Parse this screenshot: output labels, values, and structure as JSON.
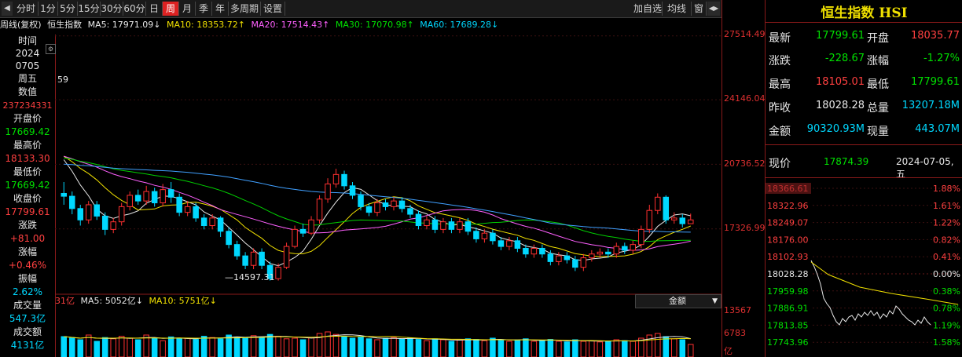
{
  "toolbar": {
    "periods": [
      "分时",
      "1分",
      "5分",
      "15分",
      "30分",
      "60分",
      "日",
      "周",
      "月",
      "季",
      "年",
      "多周期",
      "设置"
    ],
    "active": "周",
    "right_buttons": [
      "加自选",
      "均线",
      "窗"
    ]
  },
  "header": {
    "label": "周线(复权)",
    "name": "恒生指数",
    "ma5": "MA5: 17971.09↓",
    "ma10": "MA10: 18353.72↑",
    "ma20": "MA20: 17514.43↑",
    "ma30": "MA30: 17070.98↑",
    "ma60": "MA60: 17689.28↓"
  },
  "left_info": {
    "time_label": "时间",
    "year": "2024",
    "date": "0705",
    "weekday": "周五",
    "value_label": "数值",
    "value": "237234331",
    "open_label": "开盘价",
    "open": "17669.42",
    "high_label": "最高价",
    "high": "18133.30",
    "low_label": "最低价",
    "low": "17669.42",
    "close_label": "收盘价",
    "close": "17799.61",
    "change_label": "涨跌",
    "change": "+81.00",
    "pct_label": "涨幅",
    "pct": "+0.46%",
    "amp_label": "振幅",
    "amp": "2.62%",
    "vol_label": "成交量",
    "vol": "547.3亿",
    "amt_label": "成交额",
    "amt": "4131亿"
  },
  "chart_annotations": {
    "low_marker": "14597.31",
    "left_partial": "59"
  },
  "y_axis": [
    "27514.49",
    "24146.04",
    "20736.52",
    "17326.99"
  ],
  "volume": {
    "label_partial": "31亿",
    "ma5": "MA5: 5052亿↓",
    "ma10": "MA10: 5751亿↓",
    "selector": "金额",
    "ticks": [
      "13567",
      "6783"
    ],
    "unit": "亿"
  },
  "quote_panel": {
    "title": "恒生指数 HSI",
    "latest_label": "最新",
    "latest": "17799.61",
    "open_label": "开盘",
    "open": "18035.77",
    "change_label": "涨跌",
    "change": "-228.67",
    "pct_label": "涨幅",
    "pct": "-1.27%",
    "high_label": "最高",
    "high": "18105.01",
    "low_label": "最低",
    "low": "17799.61",
    "prev_label": "昨收",
    "prev": "18028.28",
    "vol_label": "总量",
    "vol": "13207.18M",
    "amt_label": "金额",
    "amt": "90320.93M",
    "cur_label": "现量",
    "cur": "443.07M",
    "now_label": "现价",
    "now": "17874.39",
    "now_date": "2024-07-05,五"
  },
  "mini_chart": {
    "left_ticks": [
      "18366.61",
      "18322.96",
      "18249.07",
      "18176.00",
      "18102.93",
      "18028.28",
      "17959.98",
      "17886.91",
      "17813.85",
      "17743.96"
    ],
    "right_ticks": [
      "1.88%",
      "1.61%",
      "1.22%",
      "0.82%",
      "0.41%",
      "0.00%",
      "0.38%",
      "0.78%",
      "1.19%",
      "1.58%"
    ]
  },
  "colors": {
    "up": "#ff3030",
    "down": "#00d8ff",
    "ma5": "#e8e8e8",
    "ma10": "#f0e000",
    "ma20": "#ff60ff",
    "ma30": "#00d000",
    "ma60": "#40a0ff"
  },
  "chart_data": {
    "type": "candlestick",
    "title": "恒生指数 周线",
    "ylim": [
      14000,
      28500
    ],
    "candles": [
      [
        19200,
        19050,
        19800,
        18600
      ],
      [
        19050,
        18400,
        19300,
        18100
      ],
      [
        18400,
        17800,
        18600,
        17500
      ],
      [
        17800,
        18600,
        18800,
        17600
      ],
      [
        18600,
        18000,
        18800,
        17800
      ],
      [
        18000,
        17300,
        18200,
        17000
      ],
      [
        17300,
        17700,
        17900,
        17100
      ],
      [
        17700,
        18500,
        18700,
        17500
      ],
      [
        18500,
        19100,
        19300,
        18300
      ],
      [
        19100,
        18800,
        19400,
        18600
      ],
      [
        18800,
        19300,
        19600,
        18600
      ],
      [
        19300,
        18700,
        19500,
        18500
      ],
      [
        18700,
        19400,
        19700,
        18500
      ],
      [
        19400,
        19000,
        19800,
        18700
      ],
      [
        19000,
        18200,
        19200,
        18000
      ],
      [
        18200,
        18500,
        18800,
        18000
      ],
      [
        18500,
        17900,
        18700,
        17700
      ],
      [
        17900,
        17500,
        18100,
        17300
      ],
      [
        17500,
        17900,
        18100,
        17300
      ],
      [
        17900,
        17200,
        18000,
        16900
      ],
      [
        17200,
        16500,
        17400,
        16300
      ],
      [
        16500,
        15900,
        16700,
        15700
      ],
      [
        15900,
        15400,
        16100,
        15200
      ],
      [
        15400,
        16100,
        16300,
        15200
      ],
      [
        16100,
        15400,
        16300,
        15200
      ],
      [
        15400,
        14700,
        15600,
        14597
      ],
      [
        14700,
        15300,
        15500,
        14597
      ],
      [
        15300,
        16400,
        16600,
        15200
      ],
      [
        16400,
        17300,
        17500,
        16300
      ],
      [
        17300,
        17100,
        17600,
        16900
      ],
      [
        17100,
        17800,
        18000,
        17000
      ],
      [
        17800,
        18900,
        19100,
        17600
      ],
      [
        18900,
        19700,
        20000,
        18700
      ],
      [
        19700,
        20200,
        20500,
        19500
      ],
      [
        20200,
        19600,
        20400,
        19400
      ],
      [
        19600,
        19100,
        19800,
        18900
      ],
      [
        19100,
        18500,
        19300,
        18300
      ],
      [
        18500,
        18200,
        18700,
        18000
      ],
      [
        18200,
        18700,
        18900,
        18000
      ],
      [
        18700,
        18500,
        18900,
        18300
      ],
      [
        18500,
        18800,
        19000,
        18300
      ],
      [
        18800,
        18400,
        19000,
        18200
      ],
      [
        18400,
        18100,
        18600,
        17900
      ],
      [
        18100,
        17500,
        18300,
        17300
      ],
      [
        17500,
        17800,
        18000,
        17300
      ],
      [
        17800,
        17300,
        18000,
        17100
      ],
      [
        17300,
        17700,
        17900,
        17100
      ],
      [
        17700,
        17300,
        17900,
        17100
      ],
      [
        17300,
        17700,
        17900,
        17100
      ],
      [
        17700,
        17200,
        17900,
        17000
      ],
      [
        17200,
        16800,
        17400,
        16600
      ],
      [
        16800,
        17100,
        17300,
        16600
      ],
      [
        17100,
        16700,
        17300,
        16500
      ],
      [
        16700,
        16400,
        16900,
        16200
      ],
      [
        16400,
        16700,
        16900,
        16200
      ],
      [
        16700,
        16300,
        16900,
        16100
      ],
      [
        16300,
        16000,
        16500,
        15800
      ],
      [
        16000,
        16300,
        16500,
        15800
      ],
      [
        16300,
        16000,
        16500,
        15800
      ],
      [
        16000,
        15600,
        16200,
        15400
      ],
      [
        15600,
        15900,
        16100,
        15400
      ],
      [
        15900,
        15700,
        16100,
        15500
      ],
      [
        15700,
        15300,
        15900,
        15100
      ],
      [
        15300,
        15800,
        16000,
        15100
      ],
      [
        15800,
        16000,
        16200,
        15600
      ],
      [
        16000,
        16100,
        16300,
        15800
      ],
      [
        16100,
        16000,
        16300,
        15800
      ],
      [
        16000,
        16400,
        16600,
        15800
      ],
      [
        16400,
        16200,
        16600,
        16000
      ],
      [
        16200,
        16500,
        16700,
        16000
      ],
      [
        16500,
        17300,
        17500,
        16300
      ],
      [
        17300,
        18300,
        18600,
        17100
      ],
      [
        18300,
        19000,
        19200,
        18100
      ],
      [
        19000,
        17800,
        19100,
        17600
      ],
      [
        17800,
        17900,
        18200,
        17600
      ],
      [
        17900,
        17600,
        18100,
        17400
      ],
      [
        17600,
        17800,
        18133,
        17669
      ]
    ],
    "volume": [
      0.65,
      0.6,
      0.55,
      0.7,
      0.5,
      0.62,
      0.58,
      0.66,
      0.6,
      0.55,
      0.7,
      0.6,
      0.52,
      0.64,
      0.58,
      0.6,
      0.56,
      0.66,
      0.62,
      0.58,
      0.7,
      0.64,
      0.6,
      0.68,
      0.62,
      0.72,
      0.66,
      0.58,
      0.6,
      0.55,
      0.62,
      0.75,
      0.8,
      0.72,
      0.66,
      0.6,
      0.64,
      0.58,
      0.55,
      0.6,
      0.62,
      0.58,
      0.6,
      0.56,
      0.52,
      0.58,
      0.55,
      0.5,
      0.54,
      0.58,
      0.56,
      0.52,
      0.6,
      0.55,
      0.5,
      0.54,
      0.58,
      0.5,
      0.52,
      0.56,
      0.5,
      0.48,
      0.55,
      0.5,
      0.52,
      0.48,
      0.5,
      0.55,
      0.52,
      0.5,
      0.6,
      0.7,
      0.75,
      0.65,
      0.58,
      0.55,
      0.4
    ]
  }
}
